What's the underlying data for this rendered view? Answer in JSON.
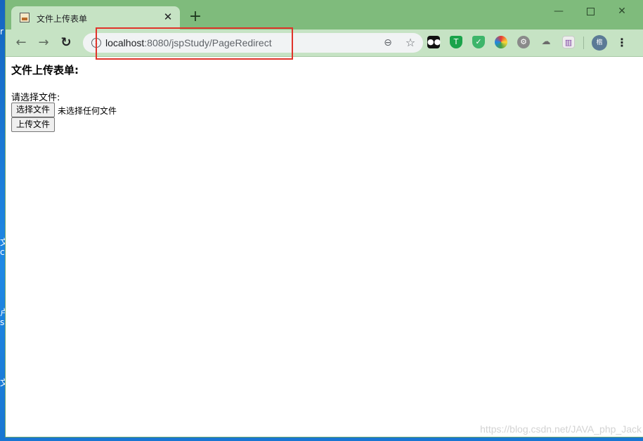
{
  "browser": {
    "tab_title": "文件上传表单",
    "tab_close": "✕",
    "new_tab": "+",
    "window_controls": {
      "minimize": "—",
      "close": "✕"
    },
    "url_host": "localhost",
    "url_rest": ":8080/jspStudy/PageRedirect",
    "avatar_text": "楷",
    "icons": [
      "back-arrow-icon",
      "forward-arrow-icon",
      "reload-icon",
      "info-icon",
      "zoom-icon",
      "star-icon",
      "menu-icon"
    ],
    "extensions": [
      "tampermonkey-icon",
      "shield-icon",
      "check-shield-icon",
      "color-wheel-icon",
      "gear-icon",
      "cloud-icon",
      "ext-icon"
    ]
  },
  "highlight_color": "#e0332a",
  "page": {
    "heading": "文件上传表单:",
    "file_label": "请选择文件:",
    "choose_button": "选择文件",
    "no_file_text": "未选择任何文件",
    "upload_button": "上传文件"
  },
  "desktop": {
    "edge_chars": [
      "r",
      "文",
      "c",
      "卢",
      "s",
      "文"
    ]
  },
  "watermark": "https://blog.csdn.net/JAVA_php_Jack"
}
